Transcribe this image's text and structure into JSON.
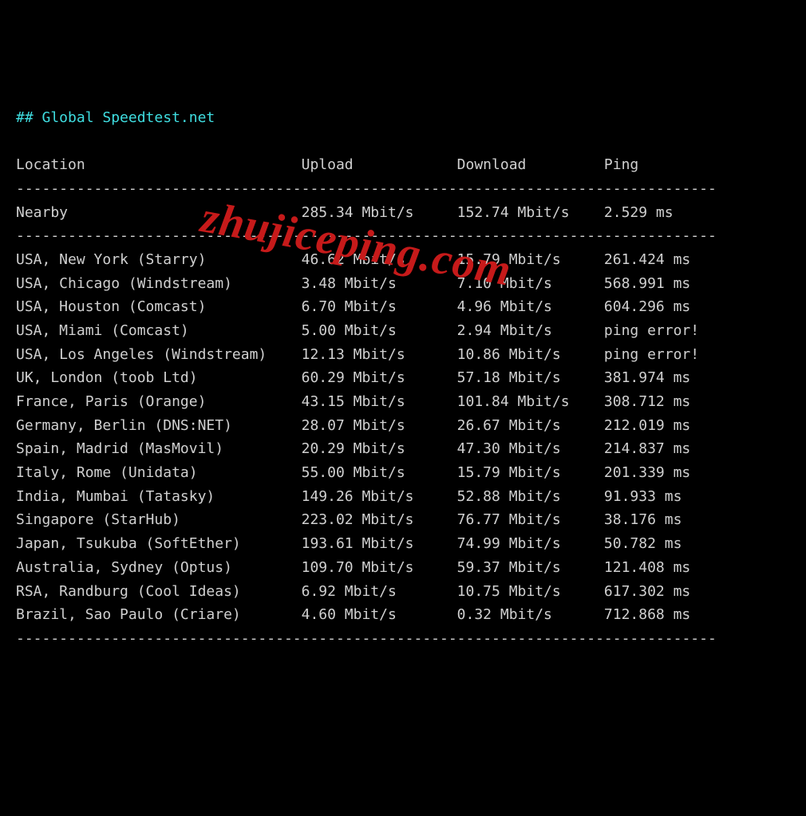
{
  "title": "## Global Speedtest.net",
  "headers": {
    "location": "Location",
    "upload": "Upload",
    "download": "Download",
    "ping": "Ping"
  },
  "nearby": {
    "location": "Nearby",
    "upload": "285.34 Mbit/s",
    "download": "152.74 Mbit/s",
    "ping": "2.529 ms"
  },
  "rows": [
    {
      "location": "USA, New York (Starry)",
      "upload": "46.62 Mbit/s",
      "download": "15.79 Mbit/s",
      "ping": "261.424 ms"
    },
    {
      "location": "USA, Chicago (Windstream)",
      "upload": "3.48 Mbit/s",
      "download": "7.10 Mbit/s",
      "ping": "568.991 ms"
    },
    {
      "location": "USA, Houston (Comcast)",
      "upload": "6.70 Mbit/s",
      "download": "4.96 Mbit/s",
      "ping": "604.296 ms"
    },
    {
      "location": "USA, Miami (Comcast)",
      "upload": "5.00 Mbit/s",
      "download": "2.94 Mbit/s",
      "ping": "ping error!"
    },
    {
      "location": "USA, Los Angeles (Windstream)",
      "upload": "12.13 Mbit/s",
      "download": "10.86 Mbit/s",
      "ping": "ping error!"
    },
    {
      "location": "UK, London (toob Ltd)",
      "upload": "60.29 Mbit/s",
      "download": "57.18 Mbit/s",
      "ping": "381.974 ms"
    },
    {
      "location": "France, Paris (Orange)",
      "upload": "43.15 Mbit/s",
      "download": "101.84 Mbit/s",
      "ping": "308.712 ms"
    },
    {
      "location": "Germany, Berlin (DNS:NET)",
      "upload": "28.07 Mbit/s",
      "download": "26.67 Mbit/s",
      "ping": "212.019 ms"
    },
    {
      "location": "Spain, Madrid (MasMovil)",
      "upload": "20.29 Mbit/s",
      "download": "47.30 Mbit/s",
      "ping": "214.837 ms"
    },
    {
      "location": "Italy, Rome (Unidata)",
      "upload": "55.00 Mbit/s",
      "download": "15.79 Mbit/s",
      "ping": "201.339 ms"
    },
    {
      "location": "India, Mumbai (Tatasky)",
      "upload": "149.26 Mbit/s",
      "download": "52.88 Mbit/s",
      "ping": "91.933 ms"
    },
    {
      "location": "Singapore (StarHub)",
      "upload": "223.02 Mbit/s",
      "download": "76.77 Mbit/s",
      "ping": "38.176 ms"
    },
    {
      "location": "Japan, Tsukuba (SoftEther)",
      "upload": "193.61 Mbit/s",
      "download": "74.99 Mbit/s",
      "ping": "50.782 ms"
    },
    {
      "location": "Australia, Sydney (Optus)",
      "upload": "109.70 Mbit/s",
      "download": "59.37 Mbit/s",
      "ping": "121.408 ms"
    },
    {
      "location": "RSA, Randburg (Cool Ideas)",
      "upload": "6.92 Mbit/s",
      "download": "10.75 Mbit/s",
      "ping": "617.302 ms"
    },
    {
      "location": "Brazil, Sao Paulo (Criare)",
      "upload": "4.60 Mbit/s",
      "download": "0.32 Mbit/s",
      "ping": "712.868 ms"
    }
  ],
  "dash_line": "---------------------------------------------------------------------------------",
  "watermark": "zhujiceping.com"
}
